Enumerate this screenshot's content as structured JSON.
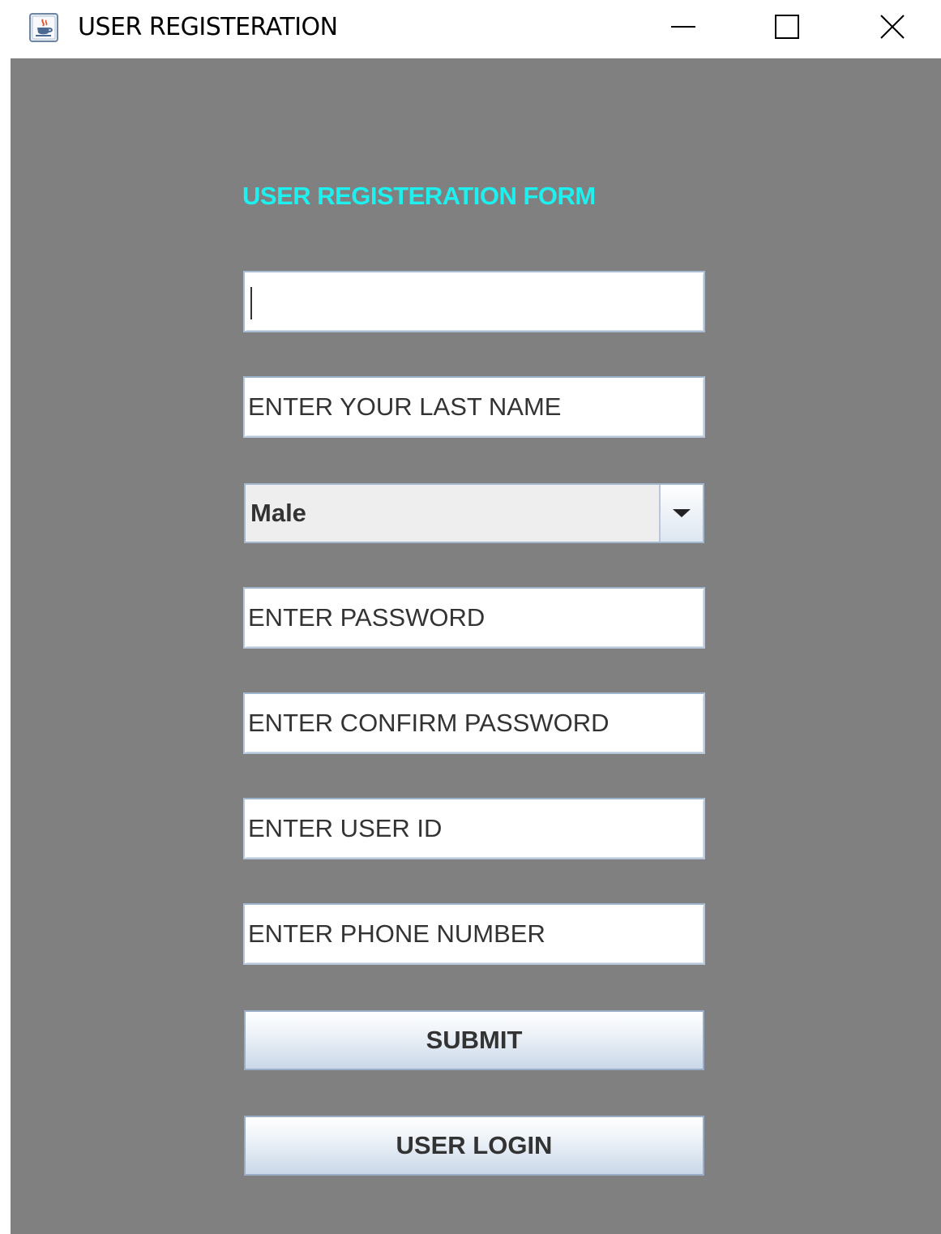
{
  "window": {
    "title": "USER REGISTERATION"
  },
  "form": {
    "heading": "USER REGISTERATION FORM",
    "first_name_value": "",
    "last_name_value": "ENTER YOUR LAST NAME",
    "gender": {
      "selected": "Male"
    },
    "password_value": "ENTER PASSWORD",
    "confirm_password_value": "ENTER CONFIRM PASSWORD",
    "user_id_value": "ENTER USER ID",
    "phone_value": "ENTER PHONE NUMBER",
    "submit_label": "SUBMIT",
    "login_label": "USER LOGIN"
  },
  "colors": {
    "client_background": "#808080",
    "heading": "#1ef0ef",
    "field_border": "#b7c8dc",
    "button_gradient_bottom": "#cad8e8"
  },
  "icons": {
    "app": "java-cup-icon",
    "minimize": "minimize-icon",
    "maximize": "maximize-icon",
    "close": "close-icon",
    "dropdown": "chevron-down-icon"
  }
}
